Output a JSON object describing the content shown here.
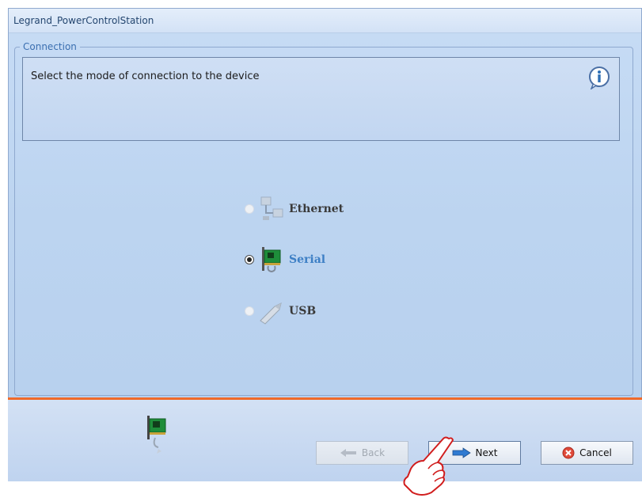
{
  "window": {
    "title": "Legrand_PowerControlStation"
  },
  "group": {
    "legend": "Connection"
  },
  "info": {
    "message": "Select the mode of connection to the device",
    "icon": "info-icon"
  },
  "options": [
    {
      "label": "Ethernet",
      "selected": false,
      "icon": "ethernet-icon"
    },
    {
      "label": "Serial",
      "selected": true,
      "icon": "serial-card-icon"
    },
    {
      "label": "USB",
      "selected": false,
      "icon": "usb-icon"
    }
  ],
  "buttons": {
    "back": "Back",
    "next": "Next",
    "cancel": "Cancel"
  },
  "colors": {
    "accent_line": "#ef6a2a",
    "selected_label": "#3d7fc5",
    "window_bg": "#bcd4f0"
  }
}
